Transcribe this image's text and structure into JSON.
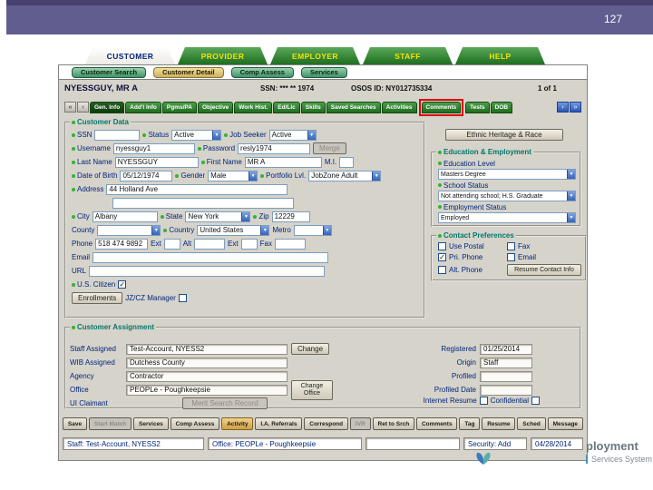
{
  "page": {
    "number": "127",
    "logo_line1": "ployment",
    "logo_line2": "Services System"
  },
  "icons": {
    "dropdown": "▼",
    "check": "✓",
    "nav_first": "«",
    "nav_prev": "‹",
    "nav_next": "›",
    "nav_last": "»"
  },
  "main_tabs": [
    "CUSTOMER",
    "PROVIDER",
    "EMPLOYER",
    "STAFF",
    "HELP"
  ],
  "sub_tabs": [
    "Customer Search",
    "Customer Detail",
    "Comp Assess",
    "Services"
  ],
  "header": {
    "name": "NYESSGUY, MR A",
    "ssn": "SSN: *** ** 1974",
    "osos": "OSOS ID: NY012735334",
    "count": "1 of 1"
  },
  "record_tabs": [
    "Gen. Info",
    "Add'l Info",
    "Pgms/PA",
    "Objective",
    "Work Hist.",
    "Ed/Lic",
    "Skills",
    "Saved Searches",
    "Activities",
    "Comments",
    "Tests",
    "DOB"
  ],
  "customer_data": {
    "legend": "Customer Data",
    "ssn_label": "SSN",
    "ssn_value": "",
    "status_label": "Status",
    "status_value": "Active",
    "job_seeker_label": "Job Seeker",
    "job_seeker_value": "Active",
    "username_label": "Username",
    "username_value": "nyessguy1",
    "password_label": "Password",
    "password_value": "resly1974",
    "merge_button": "Merge",
    "last_name_label": "Last Name",
    "last_name_value": "NYESSGUY",
    "first_name_label": "First Name",
    "first_name_value": "MR A",
    "mi_label": "M.I.",
    "mi_value": "",
    "dob_label": "Date of Birth",
    "dob_value": "05/12/1974",
    "gender_label": "Gender",
    "gender_value": "Male",
    "portfolio_label": "Portfolio Lvl.",
    "portfolio_value": "JobZone Adult",
    "address_label": "Address",
    "address_value": "44 Holland Ave",
    "address2_value": "",
    "city_label": "City",
    "city_value": "Albany",
    "state_label": "State",
    "state_value": "New York",
    "zip_label": "Zip",
    "zip_value": "12229",
    "county_label": "County",
    "county_value": "",
    "country_label": "Country",
    "country_value": "United States",
    "metro_label": "Metro",
    "metro_value": "",
    "phone_label": "Phone",
    "phone_value": "518 474 9892",
    "ext1_label": "Ext",
    "ext1_value": "",
    "alt_label": "Alt",
    "alt_value": "",
    "ext2_label": "Ext",
    "ext2_value": "",
    "fax_label": "Fax",
    "fax_value": "",
    "email_label": "Email",
    "email_value": "",
    "url_label": "URL",
    "url_value": "",
    "us_citizen_label": "U.S. Citizen",
    "enrollments_button": "Enrollments",
    "jzcz_label": "JZ/CZ Manager"
  },
  "right_panel": {
    "ethnic_button": "Ethnic Heritage & Race",
    "education": {
      "legend": "Education & Employment",
      "education_level_label": "Education Level",
      "education_level_value": "Masters Degree",
      "school_status_label": "School Status",
      "school_status_value": "Not attending school; H.S. Graduate",
      "employment_status_label": "Employment Status",
      "employment_status_value": "Employed"
    },
    "contact": {
      "legend": "Contact Preferences",
      "use_postal": "Use Postal",
      "fax": "Fax",
      "pri_phone": "Pri. Phone",
      "email": "Email",
      "alt_phone": "Alt. Phone",
      "resume_button": "Resume Contact Info"
    }
  },
  "assignment": {
    "legend": "Customer Assignment",
    "staff_label": "Staff Assigned",
    "staff_value": "Test-Account, NYESS2",
    "change_button": "Change",
    "wib_label": "WIB Assigned",
    "wib_value": "Dutchess County",
    "agency_label": "Agency",
    "agency_value": "Contractor",
    "office_label": "Office",
    "office_value": "PEOPLe - Poughkeepsie",
    "change_office_button": "Change Office",
    "ui_claimant_label": "UI Claimant",
    "merit_button": "Merit Search Record",
    "registered_label": "Registered",
    "registered_value": "01/25/2014",
    "origin_label": "Origin",
    "origin_value": "Staff",
    "profiled_label": "Profiled",
    "profiled_value": "",
    "profiled_date_label": "Profiled Date",
    "profiled_date_value": "",
    "internet_resume_label": "Internet Resume",
    "confidential_label": "Confidential"
  },
  "bottom_buttons": [
    "Save",
    "Start Match",
    "Services",
    "Comp Assess",
    "Activity",
    "I.A. Referrals",
    "Correspond",
    "IVR",
    "Ret to Srch",
    "Comments",
    "Tag",
    "Resume",
    "Sched",
    "Message"
  ],
  "status_bar": {
    "staff": "Staff: Test-Account, NYESS2",
    "office": "Office: PEOPLe - Poughkeepsie",
    "security": "Security: Add",
    "date": "04/28/2014"
  }
}
